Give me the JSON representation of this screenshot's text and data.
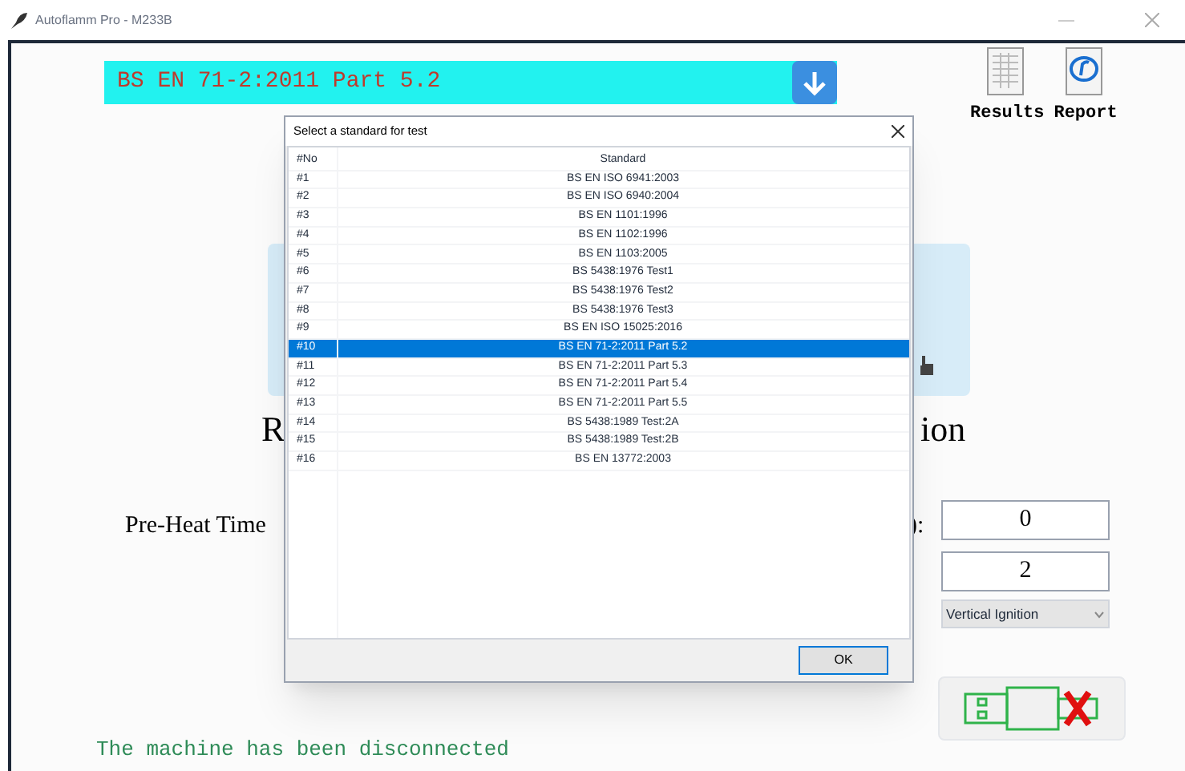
{
  "window": {
    "title": "Autoflamm Pro - M233B"
  },
  "standard_bar": {
    "value": "BS EN 71-2:2011 Part 5.2"
  },
  "tools": [
    {
      "kind": "results",
      "label": "Results"
    },
    {
      "kind": "report",
      "label": "Report"
    }
  ],
  "heading_fragments": [
    "R",
    "ion"
  ],
  "preheat": {
    "label": "Pre-Heat Time",
    "label_end": "):",
    "value": "0"
  },
  "field_2": {
    "value": "2"
  },
  "ignition_select": {
    "value": "Vertical Ignition"
  },
  "connection": {
    "connected": false
  },
  "status": "The machine has been disconnected",
  "dialog": {
    "title": "Select a standard for test",
    "columns": [
      "#No",
      "Standard"
    ],
    "rows": [
      {
        "no": "#1",
        "standard": "BS EN ISO 6941:2003",
        "selected": false
      },
      {
        "no": "#2",
        "standard": "BS EN ISO 6940:2004",
        "selected": false
      },
      {
        "no": "#3",
        "standard": "BS EN 1101:1996",
        "selected": false
      },
      {
        "no": "#4",
        "standard": "BS EN 1102:1996",
        "selected": false
      },
      {
        "no": "#5",
        "standard": "BS EN 1103:2005",
        "selected": false
      },
      {
        "no": "#6",
        "standard": "BS 5438:1976 Test1",
        "selected": false
      },
      {
        "no": "#7",
        "standard": "BS 5438:1976 Test2",
        "selected": false
      },
      {
        "no": "#8",
        "standard": "BS 5438:1976 Test3",
        "selected": false
      },
      {
        "no": "#9",
        "standard": "BS EN ISO 15025:2016",
        "selected": false
      },
      {
        "no": "#10",
        "standard": "BS EN 71-2:2011 Part 5.2",
        "selected": true
      },
      {
        "no": "#11",
        "standard": "BS EN 71-2:2011 Part 5.3",
        "selected": false
      },
      {
        "no": "#12",
        "standard": "BS EN 71-2:2011 Part 5.4",
        "selected": false
      },
      {
        "no": "#13",
        "standard": "BS EN 71-2:2011 Part 5.5",
        "selected": false
      },
      {
        "no": "#14",
        "standard": "BS 5438:1989 Test:2A",
        "selected": false
      },
      {
        "no": "#15",
        "standard": "BS 5438:1989 Test:2B",
        "selected": false
      },
      {
        "no": "#16",
        "standard": "BS EN 13772:2003",
        "selected": false
      }
    ],
    "buttons": [
      "OK"
    ]
  }
}
